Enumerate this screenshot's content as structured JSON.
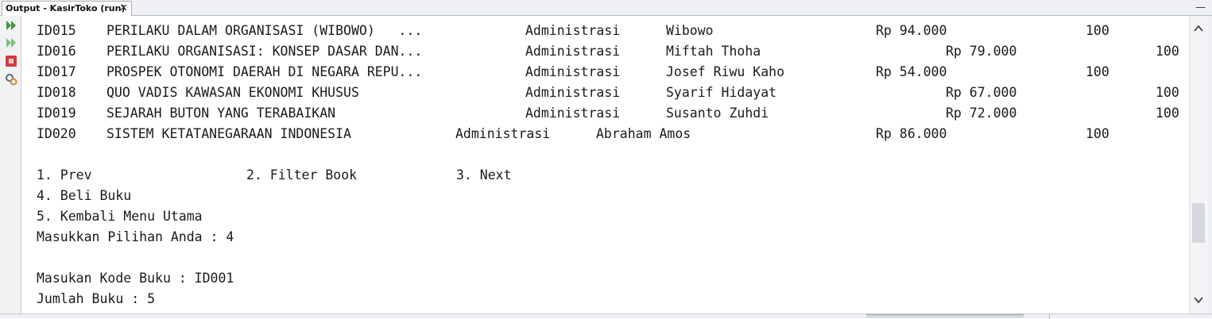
{
  "tab": {
    "title": "Output - KasirToko (run)",
    "close": "✕"
  },
  "window": {
    "minimize": "—"
  },
  "toolbar": [
    {
      "name": "rerun-icon",
      "color": "#3a9a3a"
    },
    {
      "name": "rerun-with-options-icon",
      "color": "#3a9a3a"
    },
    {
      "name": "stop-icon",
      "color": "#d33b3b"
    },
    {
      "name": "settings-icon",
      "color": "#6b7380"
    }
  ],
  "rows": [
    {
      "id": "ID015",
      "title": "PERILAKU DALAM ORGANISASI (WIBOWO)   ...",
      "category": "Administrasi",
      "author": "Wibowo",
      "price": "Rp 94.000",
      "stock": "100"
    },
    {
      "id": "ID016",
      "title": "PERILAKU ORGANISASI: KONSEP DASAR DAN...",
      "category": "Administrasi",
      "author": "Miftah Thoha",
      "price": "Rp 79.000",
      "stock": "100"
    },
    {
      "id": "ID017",
      "title": "PROSPEK OTONOMI DAERAH DI NEGARA REPU...",
      "category": "Administrasi",
      "author": "Josef Riwu Kaho",
      "price": "Rp 54.000",
      "stock": "100"
    },
    {
      "id": "ID018",
      "title": "QUO VADIS KAWASAN EKONOMI KHUSUS",
      "category": "Administrasi",
      "author": "Syarif Hidayat",
      "price": "Rp 67.000",
      "stock": "100"
    },
    {
      "id": "ID019",
      "title": "SEJARAH BUTON YANG TERABAIKAN",
      "category": "Administrasi",
      "author": "Susanto Zuhdi",
      "price": "Rp 72.000",
      "stock": "100"
    },
    {
      "id": "ID020",
      "title": "SISTEM KETATANEGARAAN INDONESIA",
      "category": "Administrasi",
      "author": "Abraham Amos",
      "price": "Rp 86.000",
      "stock": "100"
    }
  ],
  "menu": {
    "prev": "1. Prev",
    "filter": "2. Filter Book",
    "next": "3. Next",
    "beli": "4. Beli Buku",
    "kembali": "5. Kembali Menu Utama",
    "prompt": "Masukkan Pilihan Anda : 4"
  },
  "input": {
    "kode": "Masukan Kode Buku : ID001",
    "jumlah": "Jumlah Buku : 5"
  }
}
